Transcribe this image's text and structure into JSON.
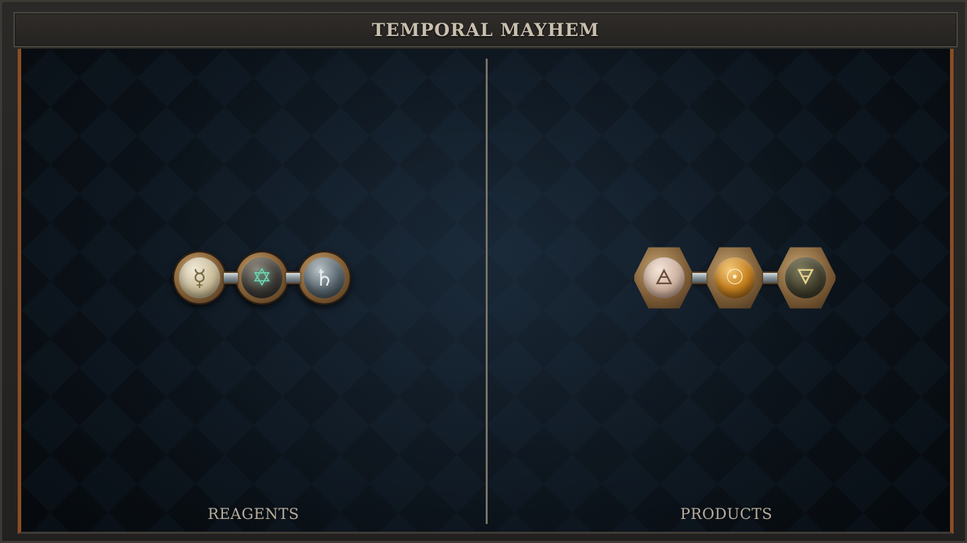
{
  "window": {
    "title": "TEMPORAL MAYHEM"
  },
  "panels": {
    "left_label": "REAGENTS",
    "right_label": "PRODUCTS"
  },
  "reagents": [
    {
      "element": "quicksilver",
      "glyph": "☿",
      "icon": "quicksilver-icon"
    },
    {
      "element": "vitae",
      "glyph": "✡",
      "icon": "vitae-icon"
    },
    {
      "element": "lead",
      "glyph": "♄",
      "icon": "lead-icon"
    }
  ],
  "products": [
    {
      "element": "air",
      "glyph": "🜁",
      "icon": "air-icon"
    },
    {
      "element": "gold",
      "glyph": "☉",
      "icon": "gold-icon"
    },
    {
      "element": "earth",
      "glyph": "🜃",
      "icon": "earth-icon"
    }
  ],
  "colors": {
    "frame_accent": "#8a4d25",
    "title_text": "#c9bfae",
    "label_text": "#b7ae9e",
    "board_bg": "#0f1a25"
  }
}
